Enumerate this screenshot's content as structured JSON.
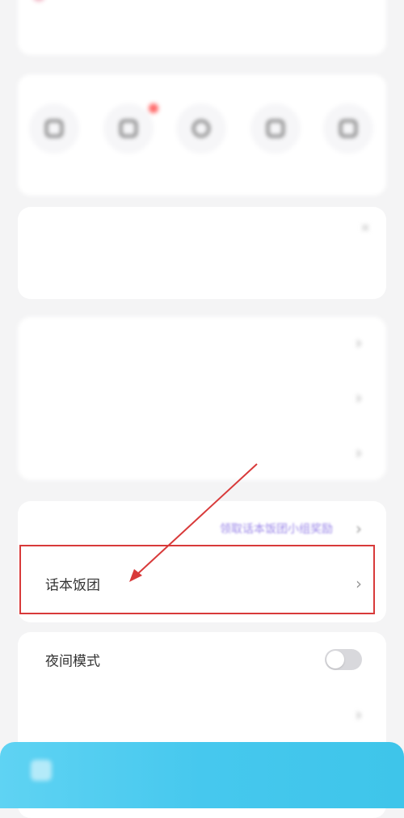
{
  "top_card": {
    "title": "",
    "subtitle": ""
  },
  "quick_actions": [
    {
      "label": "",
      "icon": "chat-icon"
    },
    {
      "label": "",
      "icon": "message-icon",
      "badge": true
    },
    {
      "label": "",
      "icon": "person-icon"
    },
    {
      "label": "",
      "icon": "gift-icon"
    },
    {
      "label": "",
      "icon": "edit-icon"
    }
  ],
  "banner": {
    "close": "×"
  },
  "list1": [
    {
      "label": "",
      "value": ""
    },
    {
      "label": "",
      "value": ""
    },
    {
      "label": "",
      "value": ""
    }
  ],
  "list2": [
    {
      "label": "",
      "value": "领取话本饭团小组奖励"
    },
    {
      "label": "话本饭团",
      "value": ""
    }
  ],
  "list3": [
    {
      "label": "夜间模式",
      "toggle": false
    },
    {
      "label": "",
      "value": ""
    }
  ],
  "chevron": "›",
  "bottom_bar": {
    "text": ""
  },
  "colors": {
    "accent_purple": "#9a86e8",
    "highlight_red": "#d83a3a",
    "bottom_blue": "#46c8ee"
  }
}
